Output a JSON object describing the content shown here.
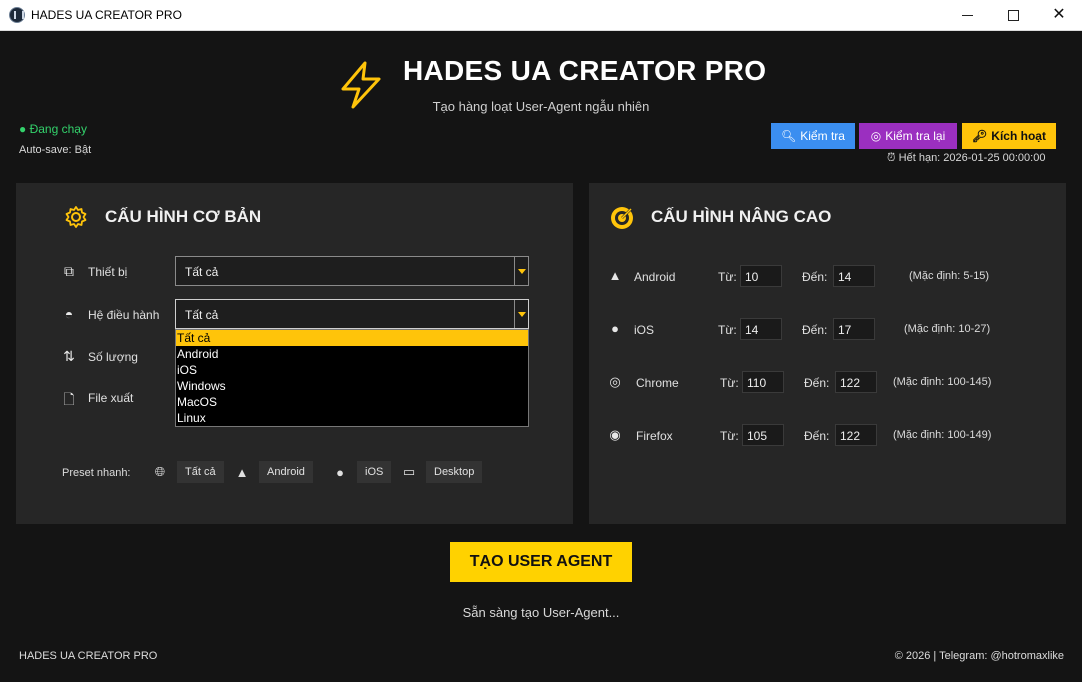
{
  "window": {
    "title": "HADES UA CREATOR PRO"
  },
  "header": {
    "title": "HADES UA CREATOR PRO",
    "subtitle": "Tạo hàng loạt User-Agent ngẫu nhiên"
  },
  "status": {
    "text": "● Đang chạy",
    "autosave": "Auto-save: Bật",
    "color": "#33d16b"
  },
  "toolbar": {
    "check_label": "Kiểm tra",
    "recheck_label": "Kiểm tra lại",
    "activate_label": "Kích hoạt",
    "expiry": "Hết hạn: 2026-01-25 00:00:00"
  },
  "basic": {
    "title": "CẤU HÌNH CƠ BẢN",
    "device_label": "Thiết bị",
    "device_value": "Tất cả",
    "os_label": "Hệ điều hành",
    "os_value": "Tất cả",
    "quantity_label": "Số lượng",
    "file_label": "File xuất",
    "os_options": [
      "Tất cả",
      "Android",
      "iOS",
      "Windows",
      "MacOS",
      "Linux"
    ],
    "preset_label": "Preset nhanh:",
    "presets": [
      "Tất cả",
      "Android",
      "iOS",
      "Desktop"
    ]
  },
  "advanced": {
    "title": "CẤU HÌNH NÂNG CAO",
    "from_label": "Từ:",
    "to_label": "Đến:",
    "rows": [
      {
        "name": "Android",
        "from": "10",
        "to": "14",
        "default": "(Mặc định: 5-15)"
      },
      {
        "name": "iOS",
        "from": "14",
        "to": "17",
        "default": "(Mặc định: 10-27)"
      },
      {
        "name": "Chrome",
        "from": "110",
        "to": "122",
        "default": "(Mặc định: 100-145)"
      },
      {
        "name": "Firefox",
        "from": "105",
        "to": "122",
        "default": "(Mặc định: 100-149)"
      }
    ]
  },
  "action": {
    "create_label": "TẠO USER AGENT",
    "ready_text": "Sẵn sàng tạo User-Agent..."
  },
  "footer": {
    "left": "HADES UA CREATOR PRO",
    "right": "© 2026 | Telegram: @hotromaxlike"
  },
  "colors": {
    "accent": "#ffd200",
    "blue": "#3b8ef0",
    "purple": "#9b2fc0",
    "panel": "#262626",
    "background": "#141414"
  }
}
